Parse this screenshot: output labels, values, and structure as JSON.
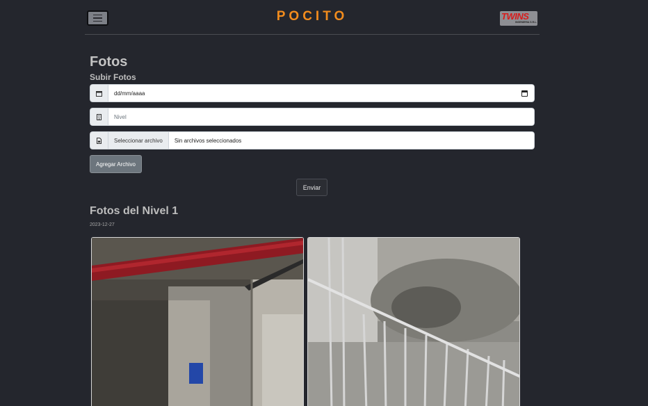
{
  "navbar": {
    "brand": "POCITO",
    "menu_icon": "hamburger-icon",
    "logo_text": "TWINS",
    "logo_subtext": "INGENIERIA S.R.L.",
    "brand_color": "#f28c1d"
  },
  "page": {
    "title": "Fotos",
    "upload_heading": "Subir Fotos"
  },
  "form": {
    "date_placeholder": "dd/mm/aaaa",
    "date_icon": "calendar-icon",
    "level_placeholder": "Nivel",
    "level_icon": "building-icon",
    "file_icon": "file-icon",
    "file_button_label": "Seleccionar archivo",
    "file_status": "Sin archivos seleccionados",
    "add_file_label": "Agregar Archivo",
    "submit_label": "Enviar"
  },
  "gallery": {
    "heading": "Fotos del Nivel 1",
    "date": "2023-12-27",
    "photos": [
      {
        "description": "construction-interior-red-pipe"
      },
      {
        "description": "construction-ceiling-metal-frame"
      }
    ]
  }
}
